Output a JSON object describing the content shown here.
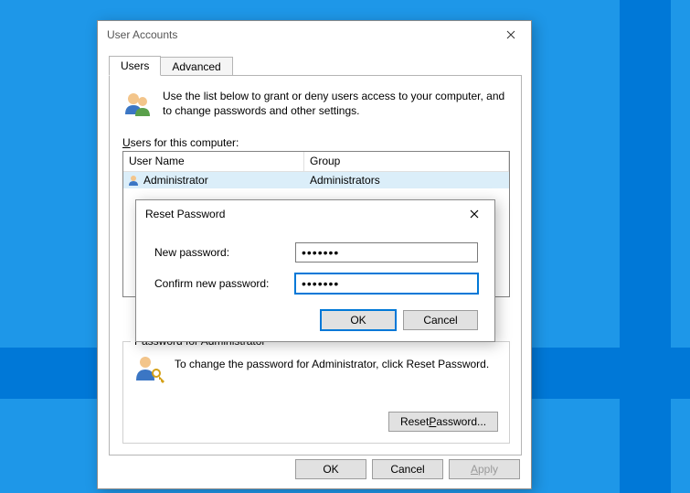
{
  "main": {
    "title": "User Accounts",
    "tabs": {
      "users": "Users",
      "advanced": "Advanced"
    },
    "intro": "Use the list below to grant or deny users access to your computer, and to change passwords and other settings.",
    "list_label_pre": "U",
    "list_label_rest": "sers for this computer:",
    "columns": {
      "name": "User Name",
      "group": "Group"
    },
    "rows": [
      {
        "name": "Administrator",
        "group": "Administrators",
        "selected": true
      }
    ],
    "pw_group_label": "Password for Administrator",
    "pw_text": "To change the password for Administrator, click Reset Password.",
    "reset_btn_pre": "Reset ",
    "reset_btn_u": "P",
    "reset_btn_rest": "assword...",
    "buttons": {
      "ok": "OK",
      "cancel": "Cancel",
      "apply_u": "A",
      "apply_rest": "pply"
    }
  },
  "modal": {
    "title": "Reset Password",
    "new_label": "New password:",
    "confirm_label": "Confirm new password:",
    "new_value": "•••••••",
    "confirm_value": "•••••••",
    "ok": "OK",
    "cancel": "Cancel"
  }
}
